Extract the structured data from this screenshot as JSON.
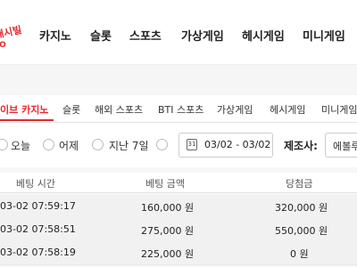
{
  "logo": {
    "text": "캐시빌",
    "sub": "iO"
  },
  "nav": [
    "카지노",
    "슬롯",
    "스포츠",
    "가상게임",
    "헤시게임",
    "미니게임"
  ],
  "tabs": [
    "이브 카지노",
    "슬롯",
    "해외 스포츠",
    "BTI 스포츠",
    "가상게임",
    "헤시게임",
    "미니게임"
  ],
  "filters": {
    "today": "오늘",
    "yesterday": "어제",
    "last7": "지난 7일",
    "date_range": "03/02 - 03/02",
    "calendar_day": "31",
    "maker_label": "제조사:",
    "maker_value": "에볼루"
  },
  "table": {
    "headers": [
      "베팅 시간",
      "베팅 금액",
      "당첨금"
    ],
    "rows": [
      [
        "03-02 07:59:17",
        "160,000 원",
        "320,000 원"
      ],
      [
        "03-02 07:58:51",
        "275,000 원",
        "550,000 원"
      ],
      [
        "03-02 07:58:19",
        "225,000 원",
        "0 원"
      ]
    ]
  },
  "colors": {
    "accent": "#e8262d"
  }
}
